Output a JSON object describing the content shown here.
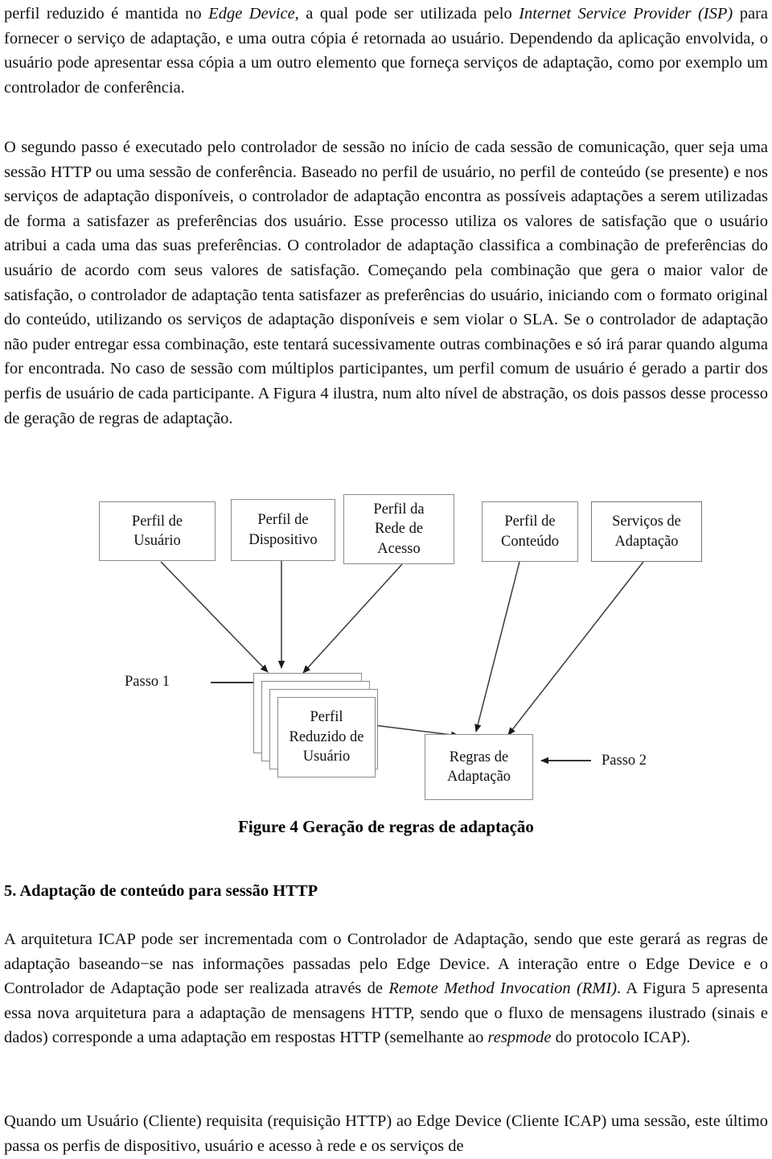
{
  "document": {
    "paragraphs": {
      "p1_pre": "perfil reduzido é mantida no ",
      "p1_em1": "Edge Device",
      "p1_mid1": ", a qual pode ser utilizada pelo ",
      "p1_em2": "Internet Service Provider (ISP)",
      "p1_mid2": " para fornecer o serviço de adaptação, e uma outra cópia é retornada ao usuário.  Dependendo da aplicação envolvida, o usuário pode apresentar essa cópia a um outro elemento que forneça serviços de adaptação, como por exemplo um controlador de conferência.",
      "p2": "O segundo passo é executado pelo controlador de sessão no início de cada sessão de comunicação, quer seja uma sessão HTTP ou uma sessão de conferência.  Baseado no perfil de usuário, no perfil de conteúdo (se presente) e nos serviços de adaptação disponíveis, o controlador de adaptação encontra as possíveis adaptações a serem utilizadas de forma a satisfazer as preferências dos usuário. Esse processo utiliza os valores de satisfação que o usuário atribui a cada uma das suas preferências. O controlador de adaptação classifica a combinação de preferências do usuário de acordo com seus valores de satisfação. Começando pela combinação que gera o maior valor de satisfação, o controlador de adaptação tenta satisfazer as preferências do usuário, iniciando com o formato original do conteúdo, utilizando os serviços de adaptação disponíveis e sem violar o SLA. Se o controlador de adaptação não puder entregar essa combinação, este tentará sucessivamente outras combinações e só irá parar quando alguma for encontrada. No caso de sessão com múltiplos participantes, um perfil comum de usuário é gerado a partir dos perfis de usuário de cada participante. A Figura 4 ilustra, num alto nível de abstração, os dois passos desse processo de geração de regras de adaptação.",
      "p3_pre": "A arquitetura ICAP pode ser incrementada com o Controlador de Adaptação, sendo que este gerará as regras de adaptação baseando−se nas informações passadas pelo Edge Device. A interação entre o Edge Device e o Controlador de Adaptação pode ser realizada através de ",
      "p3_em1": "Remote Method Invocation (RMI)",
      "p3_mid1": ". A Figura 5 apresenta essa nova arquitetura para a adaptação de mensagens HTTP, sendo que o fluxo de mensagens ilustrado (sinais e dados) corresponde a uma adaptação em respostas HTTP (semelhante ao ",
      "p3_em2": "respmode",
      "p3_tail": " do protocolo ICAP).",
      "p4": "Quando um Usuário (Cliente) requisita (requisição HTTP) ao Edge Device (Cliente ICAP) uma sessão, este último passa os perfis de dispositivo, usuário e acesso à rede e os serviços de"
    },
    "section_heading": "5. Adaptação de conteúdo para sessão HTTP"
  },
  "figure": {
    "caption": "Figure 4 Geração de regras de adaptação",
    "boxes": [
      {
        "id": "perfil-usuario",
        "line1": "Perfil de",
        "line2": "Usuário",
        "line3": ""
      },
      {
        "id": "perfil-dispositivo",
        "line1": "Perfil de",
        "line2": "Dispositivo",
        "line3": ""
      },
      {
        "id": "perfil-rede",
        "line1": "Perfil da",
        "line2": "Rede de",
        "line3": "Acesso"
      },
      {
        "id": "perfil-conteudo",
        "line1": "Perfil de",
        "line2": "Conteúdo",
        "line3": ""
      },
      {
        "id": "servicos-adaptacao",
        "line1": "Serviços de",
        "line2": "Adaptação",
        "line3": ""
      }
    ],
    "reduced_profile": {
      "line1": "Perfil",
      "line2": "Reduzido de",
      "line3": "Usuário"
    },
    "rules_box": {
      "line1": "Regras de",
      "line2": "Adaptação"
    },
    "step1_label": "Passo 1",
    "step2_label": "Passo 2",
    "colors": {
      "box_border": "#8a8a8a",
      "arrow": "#222222",
      "text": "#111111",
      "background": "#ffffff"
    }
  }
}
